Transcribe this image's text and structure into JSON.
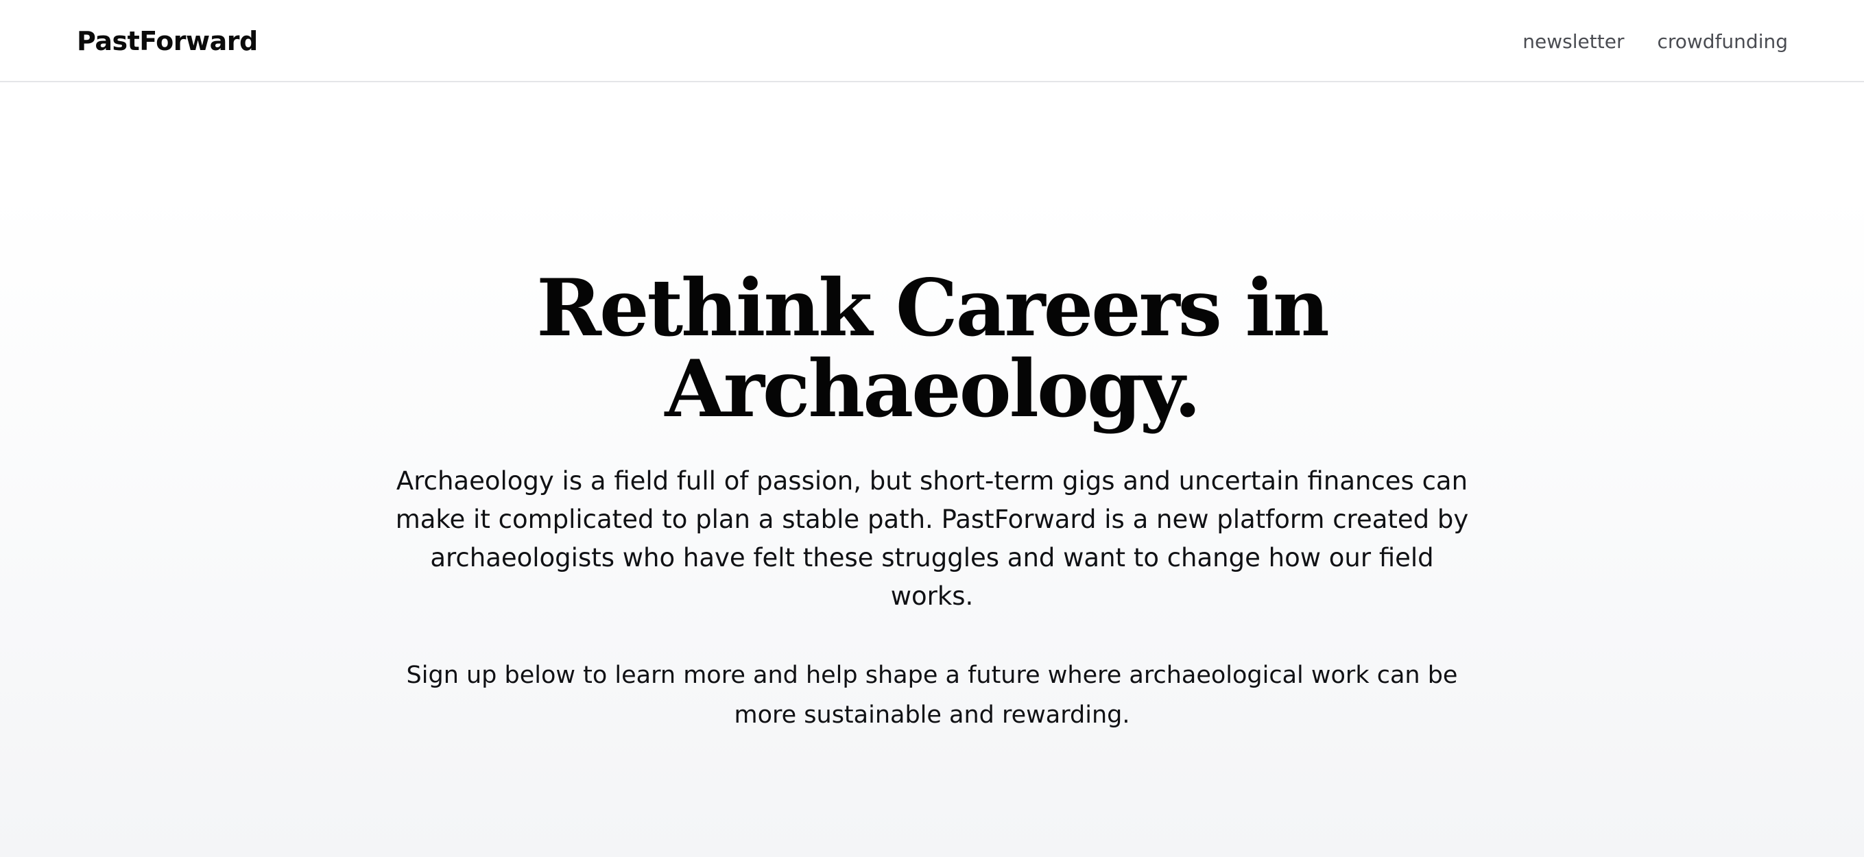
{
  "header": {
    "brand": "PastForward",
    "nav": [
      {
        "label": "newsletter"
      },
      {
        "label": "crowdfunding"
      }
    ]
  },
  "hero": {
    "title_line1": "Rethink Careers in",
    "title_line2": "Archaeology.",
    "description": "Archaeology is a field full of passion, but short-term gigs and uncertain finances can make it complicated to plan a stable path. PastForward is a new platform created by archaeologists who have felt these struggles and want to change how our field works.",
    "cta_text": "Sign up below to learn more and help shape a future where archaeological work can be more sustainable and rewarding."
  },
  "colors": {
    "text": "#0b0b0b",
    "nav_text": "#4a4c52",
    "header_border": "#e4e5e8",
    "hero_gradient_end": "#f4f5f7"
  }
}
